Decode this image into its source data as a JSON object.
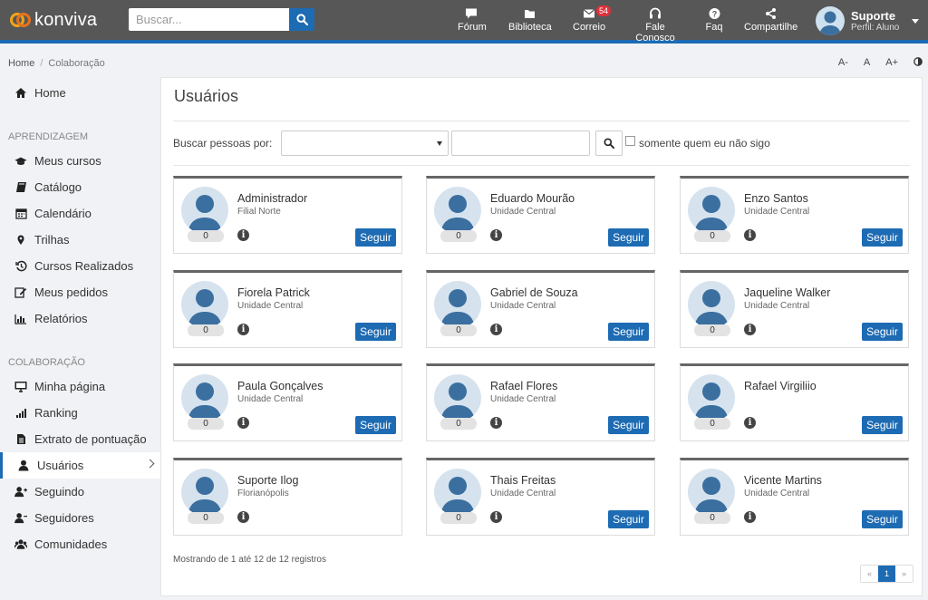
{
  "header": {
    "logo_text": "konviva",
    "search_placeholder": "Buscar...",
    "nav": [
      {
        "label": "Fórum",
        "icon": "comment-icon"
      },
      {
        "label": "Biblioteca",
        "icon": "folder-icon"
      },
      {
        "label": "Correio",
        "icon": "mail-icon",
        "badge": "54"
      },
      {
        "label": "Fale Conosco",
        "icon": "headset-icon"
      },
      {
        "label": "Faq",
        "icon": "question-icon"
      },
      {
        "label": "Compartilhe",
        "icon": "share-icon"
      }
    ],
    "profile": {
      "name": "Suporte",
      "role": "Perfil: Aluno"
    }
  },
  "breadcrumb": {
    "home": "Home",
    "current": "Colaboração"
  },
  "font_tools": [
    "A-",
    "A",
    "A+"
  ],
  "sidebar": {
    "top": [
      {
        "label": "Home",
        "icon": "home-icon"
      }
    ],
    "sections": [
      {
        "title": "APRENDIZAGEM",
        "items": [
          {
            "label": "Meus cursos",
            "icon": "graduation-cap-icon"
          },
          {
            "label": "Catálogo",
            "icon": "book-icon"
          },
          {
            "label": "Calendário",
            "icon": "calendar-icon"
          },
          {
            "label": "Trilhas",
            "icon": "map-marker-icon"
          },
          {
            "label": "Cursos Realizados",
            "icon": "history-icon"
          },
          {
            "label": "Meus pedidos",
            "icon": "edit-icon"
          },
          {
            "label": "Relatórios",
            "icon": "bar-chart-icon"
          }
        ]
      },
      {
        "title": "COLABORAÇÃO",
        "items": [
          {
            "label": "Minha página",
            "icon": "monitor-icon"
          },
          {
            "label": "Ranking",
            "icon": "signal-icon"
          },
          {
            "label": "Extrato de pontuação",
            "icon": "document-icon"
          },
          {
            "label": "Usuários",
            "icon": "user-icon",
            "active": true
          },
          {
            "label": "Seguindo",
            "icon": "user-follow-icon"
          },
          {
            "label": "Seguidores",
            "icon": "user-followers-icon"
          },
          {
            "label": "Comunidades",
            "icon": "users-icon"
          }
        ]
      }
    ]
  },
  "main": {
    "title": "Usuários",
    "filter_label": "Buscar pessoas por:",
    "select_value": "",
    "text_value": "",
    "checkbox_label": "somente quem eu não sigo",
    "checkbox_checked": false,
    "follow_label": "Seguir",
    "users": [
      {
        "name": "Administrador",
        "unit": "Filial Norte",
        "count": "0",
        "follow": true
      },
      {
        "name": "Eduardo Mourão",
        "unit": "Unidade Central",
        "count": "0",
        "follow": true
      },
      {
        "name": "Enzo Santos",
        "unit": "Unidade Central",
        "count": "0",
        "follow": true
      },
      {
        "name": "Fiorela Patrick",
        "unit": "Unidade Central",
        "count": "0",
        "follow": true
      },
      {
        "name": "Gabriel de Souza",
        "unit": "Unidade Central",
        "count": "0",
        "follow": true
      },
      {
        "name": "Jaqueline Walker",
        "unit": "Unidade Central",
        "count": "0",
        "follow": true
      },
      {
        "name": "Paula Gonçalves",
        "unit": "Unidade Central",
        "count": "0",
        "follow": true
      },
      {
        "name": "Rafael Flores",
        "unit": "Unidade Central",
        "count": "0",
        "follow": true
      },
      {
        "name": "Rafael Virgiliio",
        "unit": "",
        "count": "0",
        "follow": true
      },
      {
        "name": "Suporte Ilog",
        "unit": "Florianópolis",
        "count": "0",
        "follow": false
      },
      {
        "name": "Thais Freitas",
        "unit": "Unidade Central",
        "count": "0",
        "follow": true
      },
      {
        "name": "Vicente Martins",
        "unit": "Unidade Central",
        "count": "0",
        "follow": true
      }
    ],
    "records_text": "Mostrando de 1 até 12 de 12 registros",
    "pagination": {
      "prev": "«",
      "current": "1",
      "next": "»"
    }
  },
  "colors": {
    "accent": "#1d6bb3",
    "topbar": "#575757",
    "badge": "#e0303a"
  }
}
